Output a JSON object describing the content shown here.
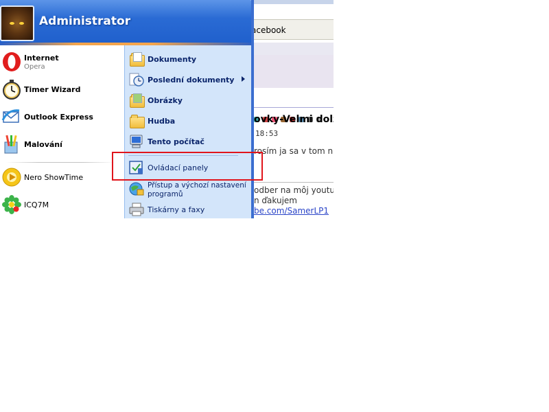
{
  "start_menu": {
    "user_name": "Administrator",
    "pinned": [
      {
        "label": "Internet",
        "sub": "Opera",
        "icon": "opera-icon"
      },
      {
        "label": "Timer Wizard",
        "icon": "stopwatch-icon"
      },
      {
        "label": "Outlook Express",
        "icon": "outlook-express-icon"
      },
      {
        "label": "Malování",
        "icon": "paint-icon"
      }
    ],
    "recent": [
      {
        "label": "Nero ShowTime",
        "icon": "nero-icon"
      },
      {
        "label": "ICQ7M",
        "icon": "icq-flower-icon"
      }
    ],
    "places": [
      {
        "label": "Dokumenty",
        "icon": "documents-folder-icon"
      },
      {
        "label": "Poslední dokumenty",
        "icon": "recent-documents-icon",
        "has_submenu": true
      },
      {
        "label": "Obrázky",
        "icon": "pictures-folder-icon"
      },
      {
        "label": "Hudba",
        "icon": "music-folder-icon"
      },
      {
        "label": "Tento počítač",
        "icon": "my-computer-icon"
      }
    ],
    "system": [
      {
        "label": "Ovládací panely",
        "icon": "control-panel-icon"
      },
      {
        "label": "Přístup a výchozí nastavení programů",
        "icon": "program-access-icon"
      },
      {
        "label": "Tiskárny a faxy",
        "icon": "printers-icon"
      }
    ]
  },
  "browser": {
    "address_fragment": "acebook",
    "post_title": "ovky-Velmi dolzit",
    "post_time": "18:53",
    "post_text": "rosím ja sa v tom n",
    "footer_line1": "odber na môj youtul",
    "footer_line2": "n ďakujem",
    "footer_link": "be.com/SamerLP1"
  },
  "colors": {
    "header_blue": "#2a6bd4",
    "right_pane": "#d3e5fa",
    "highlight_red": "#e0141b",
    "link_blue": "#2b45c8"
  }
}
